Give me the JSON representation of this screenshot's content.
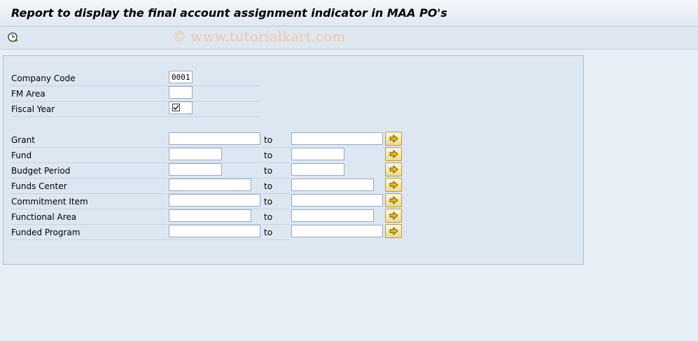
{
  "title": "Report to display the final account assignment indicator in MAA PO's",
  "watermark": "© www.tutorialkart.com",
  "toolbar": {
    "execute_icon": "clock-execute-icon"
  },
  "params": [
    {
      "label": "Company Code",
      "value": "0001"
    },
    {
      "label": "FM Area",
      "value": ""
    },
    {
      "label": "Fiscal Year",
      "value": "",
      "checked": true
    }
  ],
  "ranges": [
    {
      "label": "Grant",
      "low": "",
      "high": ""
    },
    {
      "label": "Fund",
      "low": "",
      "high": ""
    },
    {
      "label": "Budget Period",
      "low": "",
      "high": ""
    },
    {
      "label": "Funds Center",
      "low": "",
      "high": ""
    },
    {
      "label": "Commitment Item",
      "low": "",
      "high": ""
    },
    {
      "label": "Functional Area",
      "low": "",
      "high": ""
    },
    {
      "label": "Funded Program",
      "low": "",
      "high": ""
    }
  ],
  "to_label": "to",
  "colors": {
    "accent_button": "#efd98c",
    "frame_bg": "#dde7f2"
  }
}
